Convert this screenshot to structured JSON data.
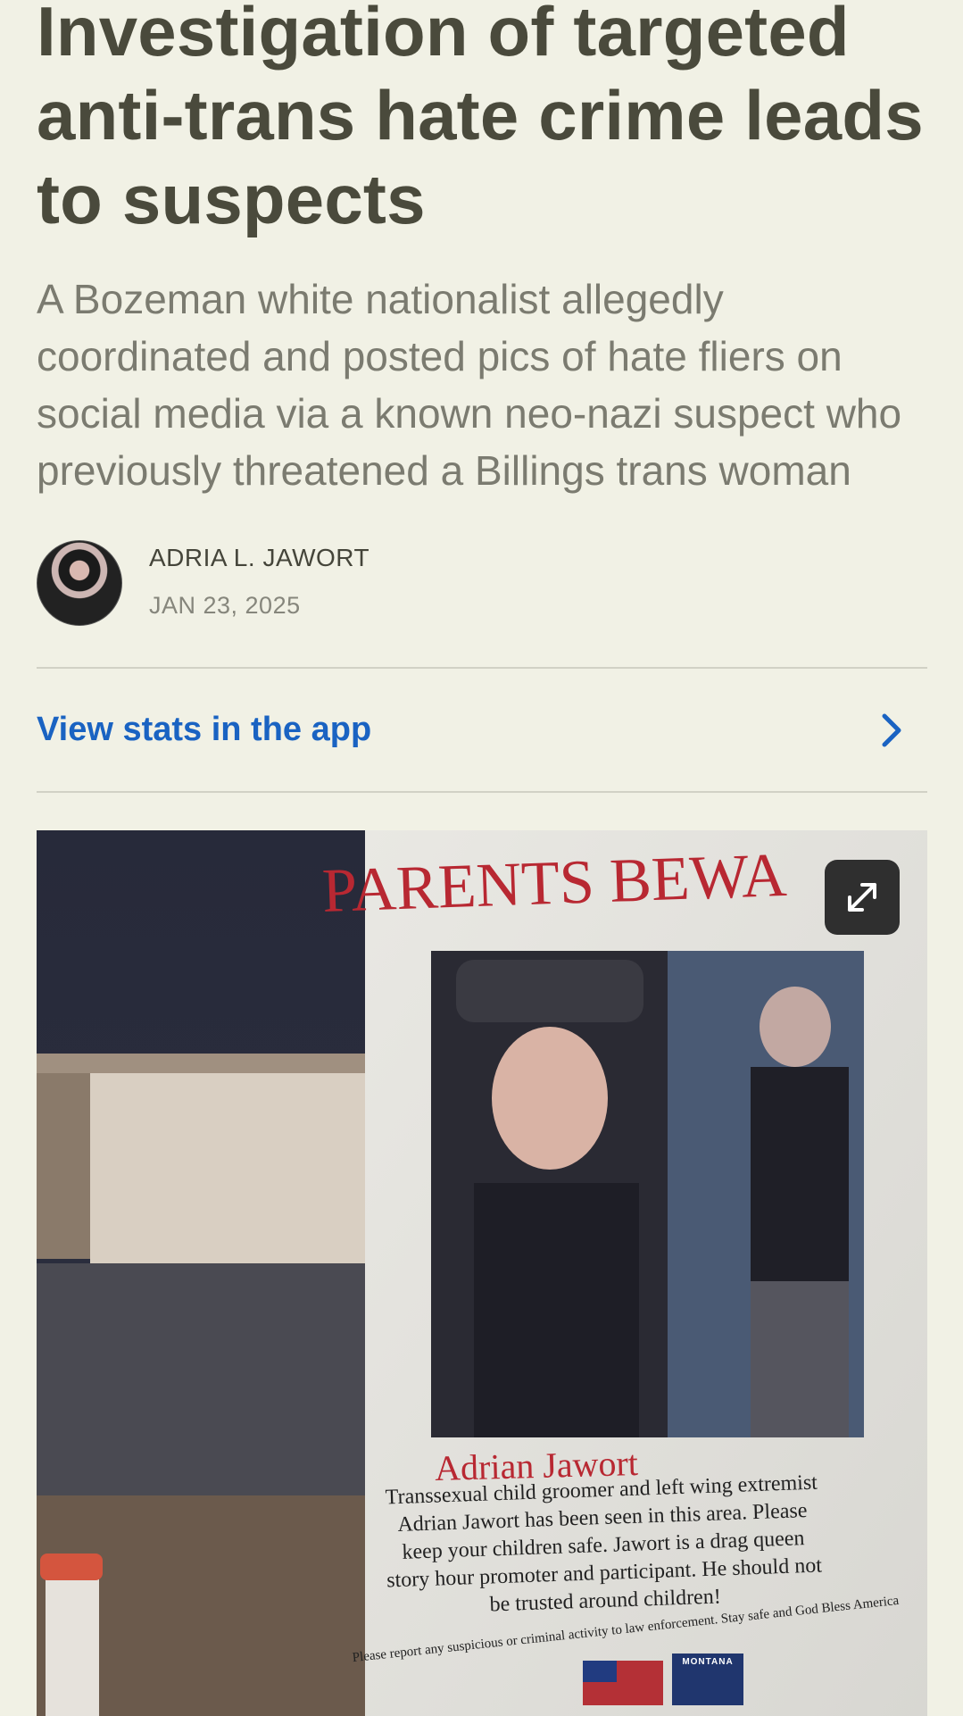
{
  "article": {
    "title": "Investigation of targeted anti-trans hate crime leads to suspects",
    "subtitle": "A Bozeman white nationalist allegedly coordinated and posted pics of hate fliers on social media via a known neo-nazi suspect who previously threatened a Billings trans woman"
  },
  "byline": {
    "author": "ADRIA L. JAWORT",
    "date": "JAN 23, 2025"
  },
  "stats_link": {
    "label": "View stats in the app",
    "icon": "chevron-right-icon"
  },
  "photo": {
    "expand_icon": "expand-icon",
    "flyer": {
      "heading": "PARENTS BEWA",
      "name": "Adrian Jawort",
      "body": "Transsexual child groomer and left wing extremist Adrian Jawort has been seen in this area. Please keep your children safe. Jawort is a drag queen story hour promoter and participant. He should not be trusted around children!",
      "footer": "Please report any suspicious or criminal activity to law enforcement. Stay safe and God Bless America",
      "badge": "MONTANA"
    }
  },
  "colors": {
    "background": "#f1f1e5",
    "title": "#4a4a3c",
    "link": "#1a63c2",
    "flyer_red": "#b82832"
  }
}
